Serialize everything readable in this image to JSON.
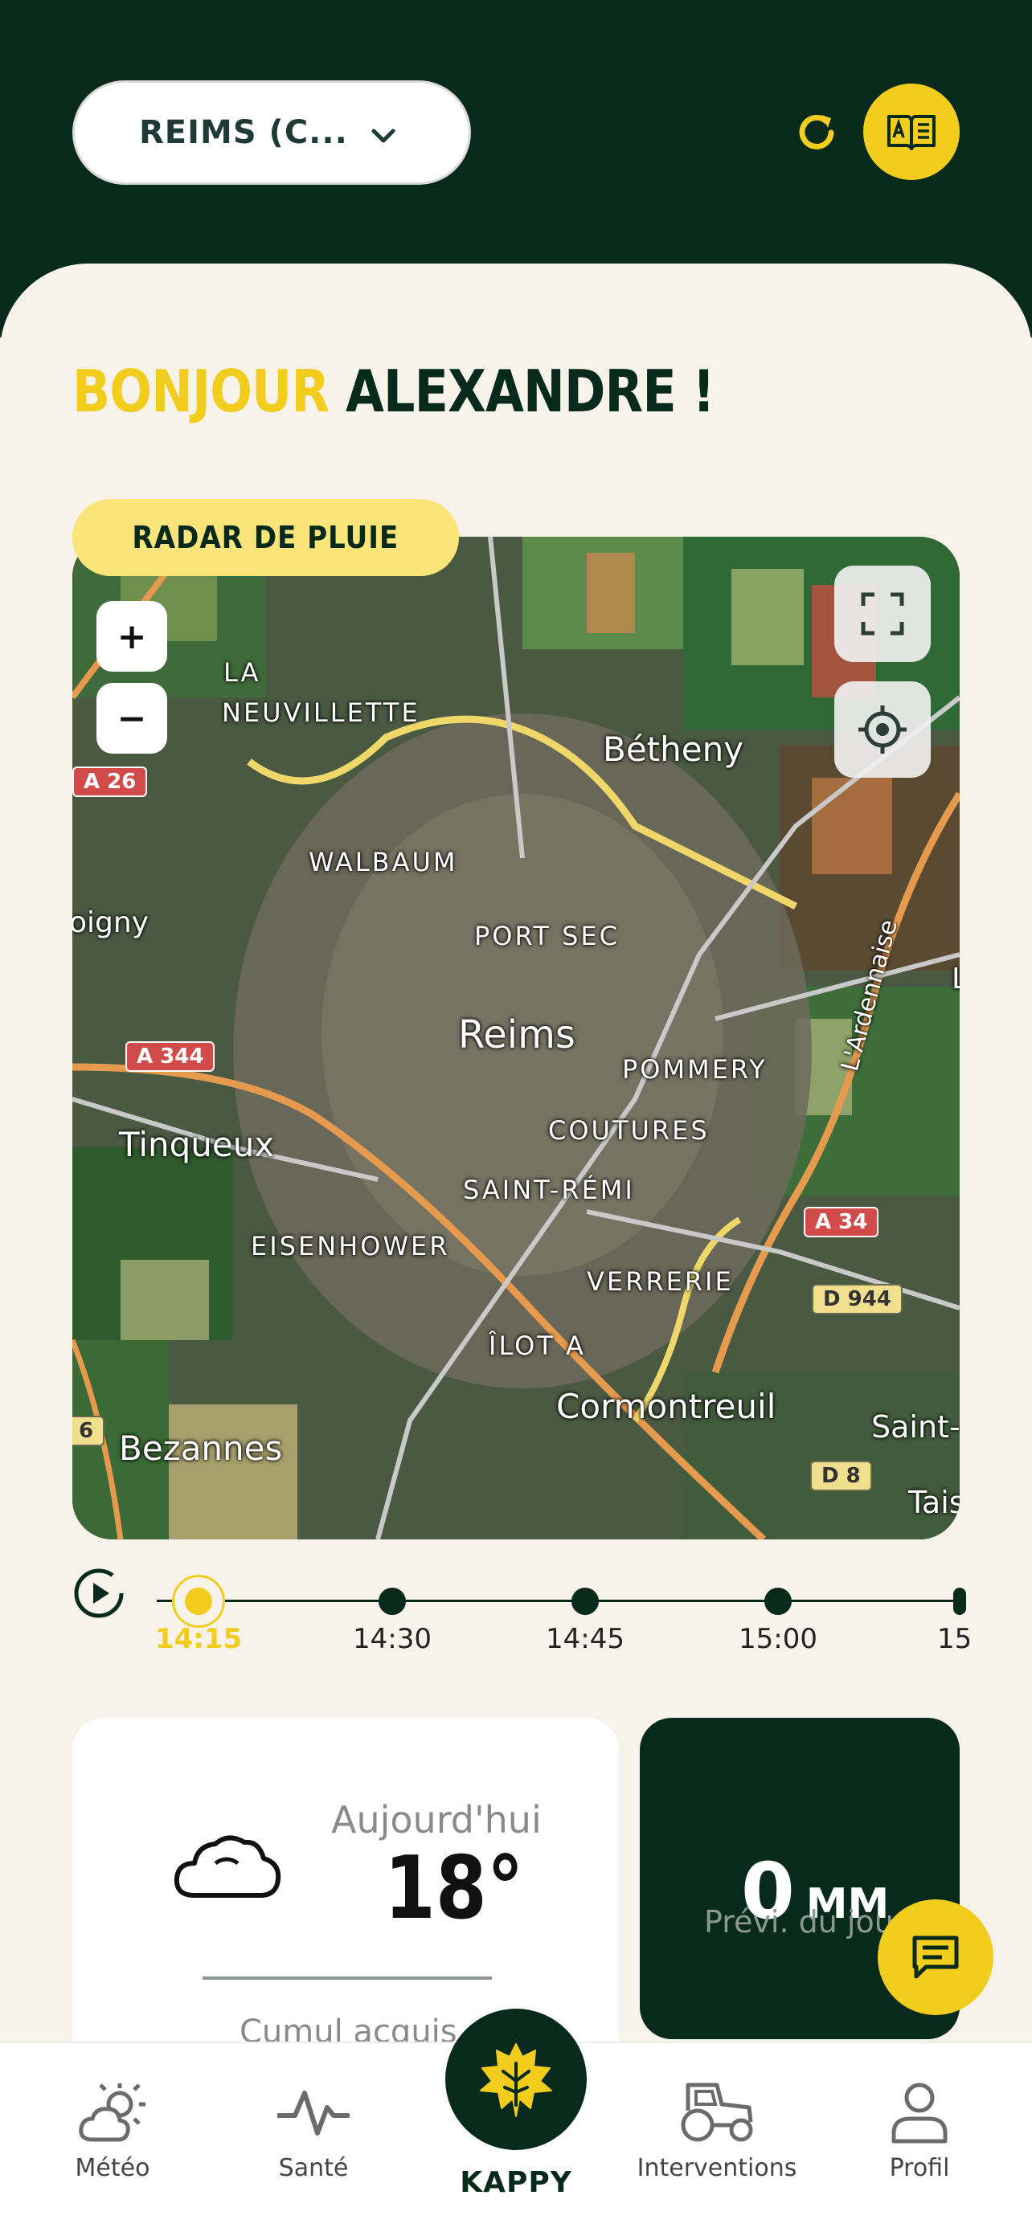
{
  "header": {
    "location": "REIMS (C...",
    "colors": {
      "dark_green": "#082a1c",
      "yellow": "#f2cd1d"
    }
  },
  "greeting": {
    "hello": "BONJOUR",
    "name": "ALEXANDRE !"
  },
  "radar": {
    "title": "RADAR DE PLUIE",
    "zoom_in": "+",
    "zoom_out": "−",
    "labels": {
      "la_neuvillette": "LA\nNEUVILLETTE",
      "betheny": "Bétheny",
      "walbaum": "WALBAUM",
      "oigny": "oigny",
      "port_sec": "PORT SEC",
      "reims": "Reims",
      "pommery": "POMMERY",
      "tinqueux": "Tinqueux",
      "coutures": "COUTURES",
      "saint_remi": "SAINT-RÉMI",
      "eisenhower": "EISENHOWER",
      "verrerie": "VERRERIE",
      "ilot_a": "ÎLOT A",
      "cormontreuil": "Cormontreuil",
      "bezannes": "Bezannes",
      "saint": "Saint-",
      "tais": "Tais",
      "ardennaise": "L'Ardennaise",
      "l": "L"
    },
    "road_signs": {
      "a26": "A 26",
      "a344": "A 344",
      "a34": "A 34",
      "d944": "D 944",
      "d8": "D 8",
      "six": "6"
    }
  },
  "timeline": {
    "times": [
      "14:15",
      "14:30",
      "14:45",
      "15:00",
      "15"
    ],
    "active_index": 0
  },
  "weather_card": {
    "day": "Aujourd'hui",
    "temperature": "18°",
    "icon": "cloud-icon",
    "cumul_label": "Cumul acquis"
  },
  "rain_card": {
    "value": "0",
    "unit": "MM",
    "subtitle": "Prévi. du jour"
  },
  "bottom_nav": {
    "meteo": "Météo",
    "sante": "Santé",
    "kappy": "KAPPY",
    "interventions": "Interventions",
    "profil": "Profil"
  }
}
